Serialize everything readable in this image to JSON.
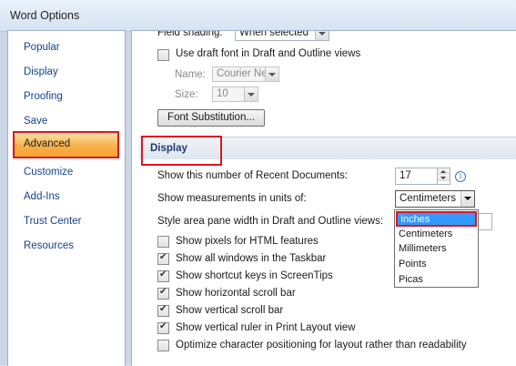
{
  "window": {
    "title": "Word Options"
  },
  "sidebar": {
    "items": [
      {
        "label": "Popular"
      },
      {
        "label": "Display"
      },
      {
        "label": "Proofing"
      },
      {
        "label": "Save"
      },
      {
        "label": "Advanced",
        "selected": true
      },
      {
        "label": "Customize"
      },
      {
        "label": "Add-Ins"
      },
      {
        "label": "Trust Center"
      },
      {
        "label": "Resources"
      }
    ]
  },
  "content": {
    "field_shading": {
      "label": "Field shading:",
      "value": "When selected"
    },
    "draft_font": {
      "label": "Use draft font in Draft and Outline views",
      "checked": false
    },
    "name": {
      "label": "Name:",
      "value": "Courier New"
    },
    "size": {
      "label": "Size:",
      "value": "10"
    },
    "font_substitution_button": "Font Substitution...",
    "display_section": {
      "title": "Display"
    },
    "recent_docs": {
      "label": "Show this number of Recent Documents:",
      "value": "17"
    },
    "measurement_units": {
      "label": "Show measurements in units of:",
      "value": "Centimeters",
      "options": [
        "Inches",
        "Centimeters",
        "Millimeters",
        "Points",
        "Picas"
      ],
      "highlighted": "Inches"
    },
    "style_area": {
      "label": "Style area pane width in Draft and Outline views:"
    },
    "checkboxes": [
      {
        "label": "Show pixels for HTML features",
        "checked": false
      },
      {
        "label": "Show all windows in the Taskbar",
        "checked": true
      },
      {
        "label": "Show shortcut keys in ScreenTips",
        "checked": true
      },
      {
        "label": "Show horizontal scroll bar",
        "checked": true
      },
      {
        "label": "Show vertical scroll bar",
        "checked": true
      },
      {
        "label": "Show vertical ruler in Print Layout view",
        "checked": true
      },
      {
        "label": "Optimize character positioning for layout rather than readability",
        "checked": false
      }
    ]
  },
  "icons": {
    "info": "info-icon",
    "dropdown": "chevron-down-icon"
  },
  "colors": {
    "highlight_border": "#e0141f",
    "selection": "#3399ff",
    "nav_text": "#15428b"
  }
}
